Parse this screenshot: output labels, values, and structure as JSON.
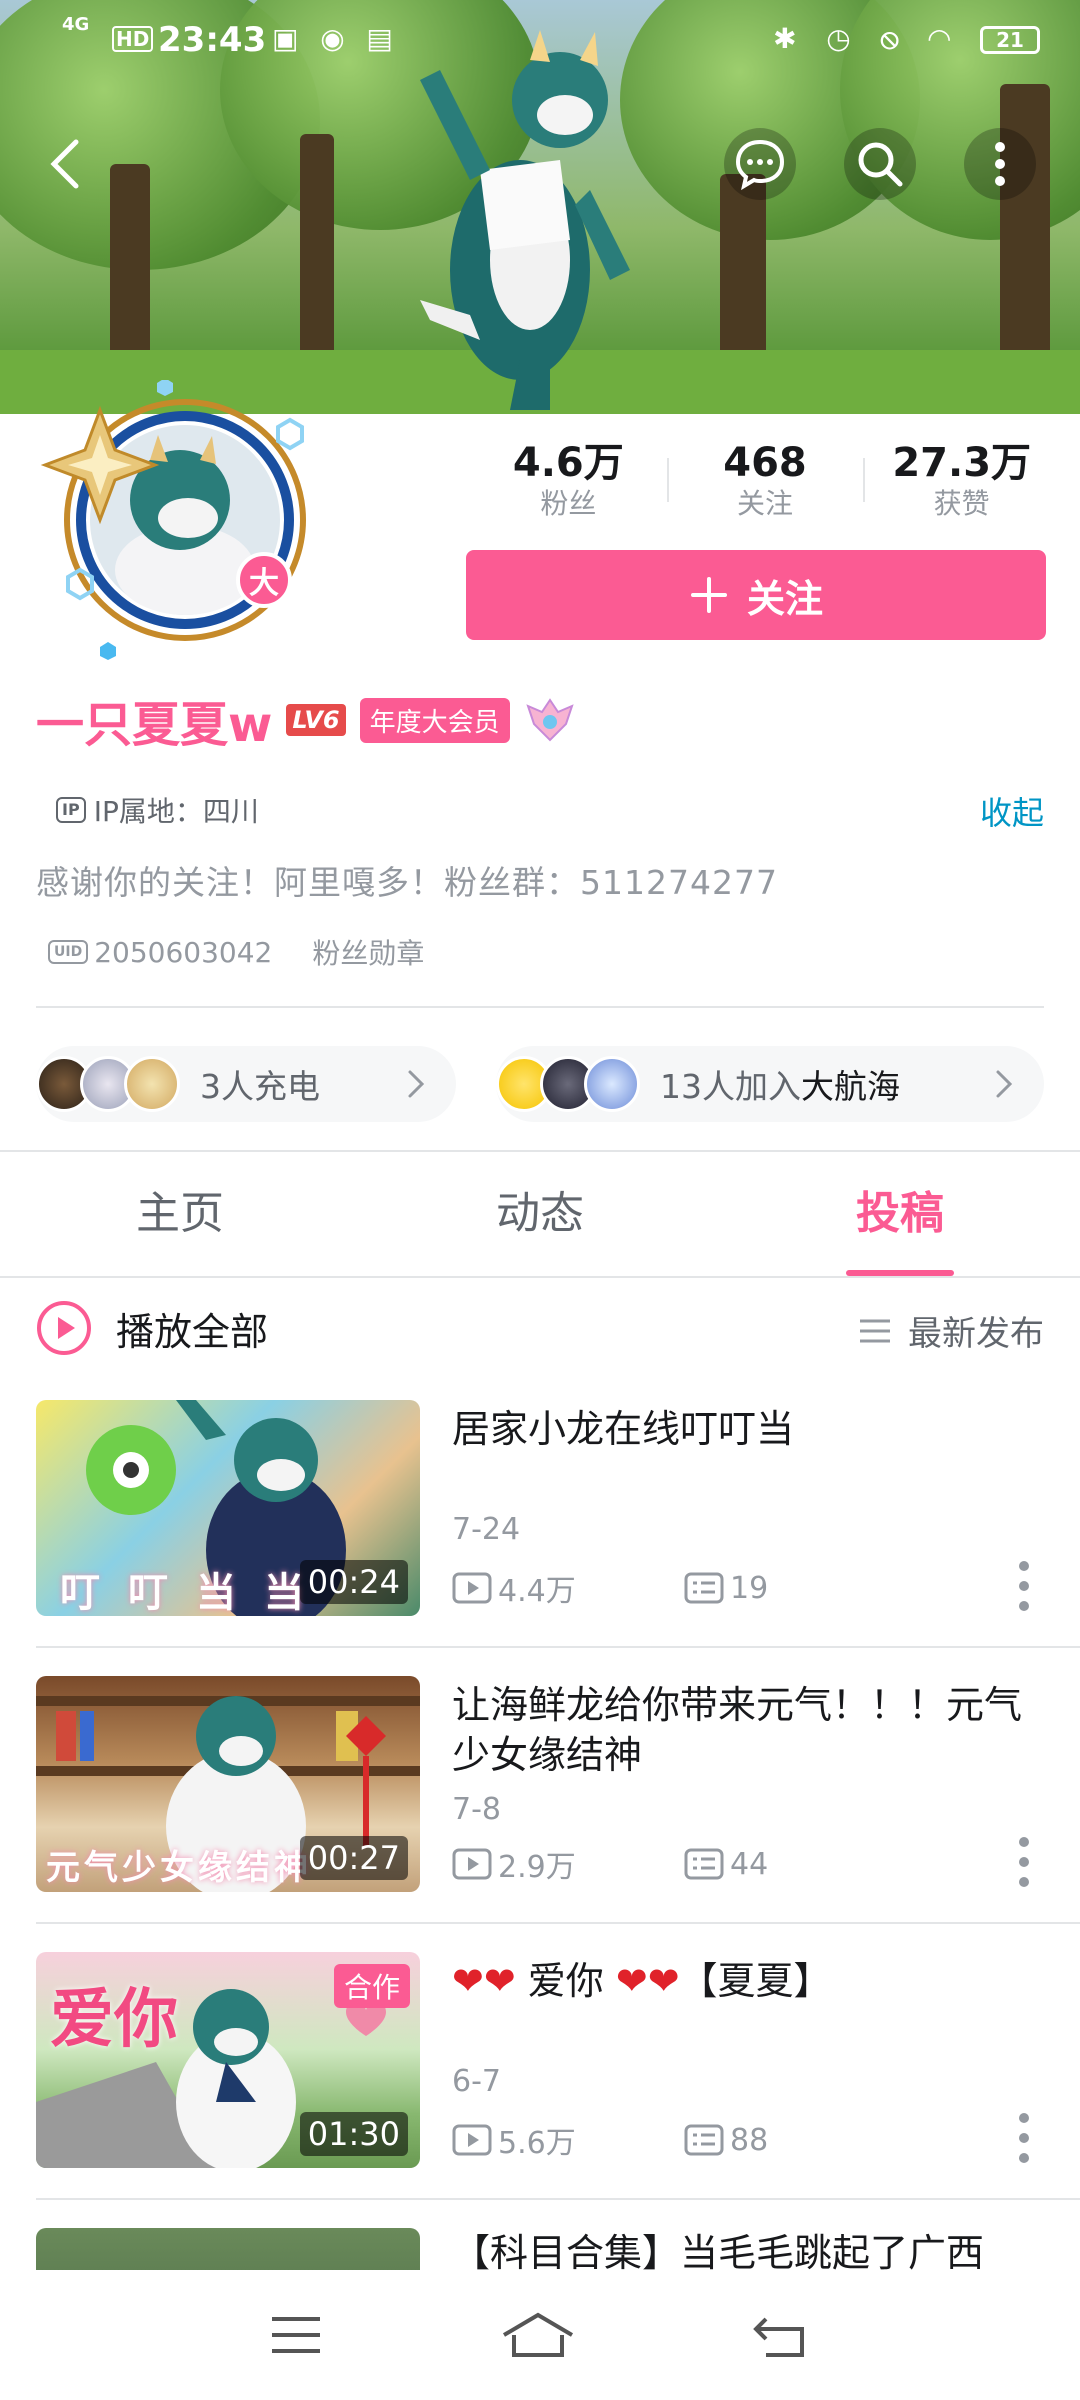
{
  "status_bar": {
    "time": "23:43",
    "network": "4G",
    "hd": "HD",
    "battery": "21"
  },
  "header": {
    "icons": [
      "back-icon",
      "message-icon",
      "search-icon",
      "more-icon"
    ]
  },
  "profile": {
    "stats": [
      {
        "value": "4.6万",
        "label": "粉丝"
      },
      {
        "value": "468",
        "label": "关注"
      },
      {
        "value": "27.3万",
        "label": "获赞"
      }
    ],
    "follow_label": "关注",
    "avatar_badge": "大",
    "username": "一只夏夏w",
    "level": "LV6",
    "vip_badge": "年度大会员",
    "ip_tag": "IP",
    "ip_location": "IP属地：四川",
    "collapse_label": "收起",
    "bio": "感谢你的关注！阿里嘎多！粉丝群：511274277",
    "uid_tag": "UID",
    "uid": "2050603042",
    "fan_medal": "粉丝勋章"
  },
  "supporters": {
    "charge_text": "3人充电",
    "fleet_prefix": "13人加入",
    "fleet_suffix": "大航海"
  },
  "tabs": [
    {
      "label": "主页",
      "active": false
    },
    {
      "label": "动态",
      "active": false
    },
    {
      "label": "投稿",
      "active": true
    }
  ],
  "list_header": {
    "play_all": "播放全部",
    "sort": "最新发布"
  },
  "videos": [
    {
      "title": "居家小龙在线叮叮当",
      "date": "7-24",
      "views": "4.4万",
      "comments": "19",
      "duration": "00:24",
      "thumb_text": "叮叮当当"
    },
    {
      "title": "让海鲜龙给你带来元气！！！元气少女缘结神",
      "date": "7-8",
      "views": "2.9万",
      "comments": "44",
      "duration": "00:27",
      "thumb_text": "元气少女缘结神"
    },
    {
      "title": "❤❤ 爱你 ❤❤【夏夏】",
      "date": "6-7",
      "views": "5.6万",
      "comments": "88",
      "duration": "01:30",
      "collab": "合作",
      "thumb_text": "爱你"
    },
    {
      "title": "【科目合集】当毛毛跳起了广西"
    }
  ],
  "colors": {
    "accent": "#fb5b93",
    "link": "#0095c5",
    "muted": "#9499a0"
  }
}
